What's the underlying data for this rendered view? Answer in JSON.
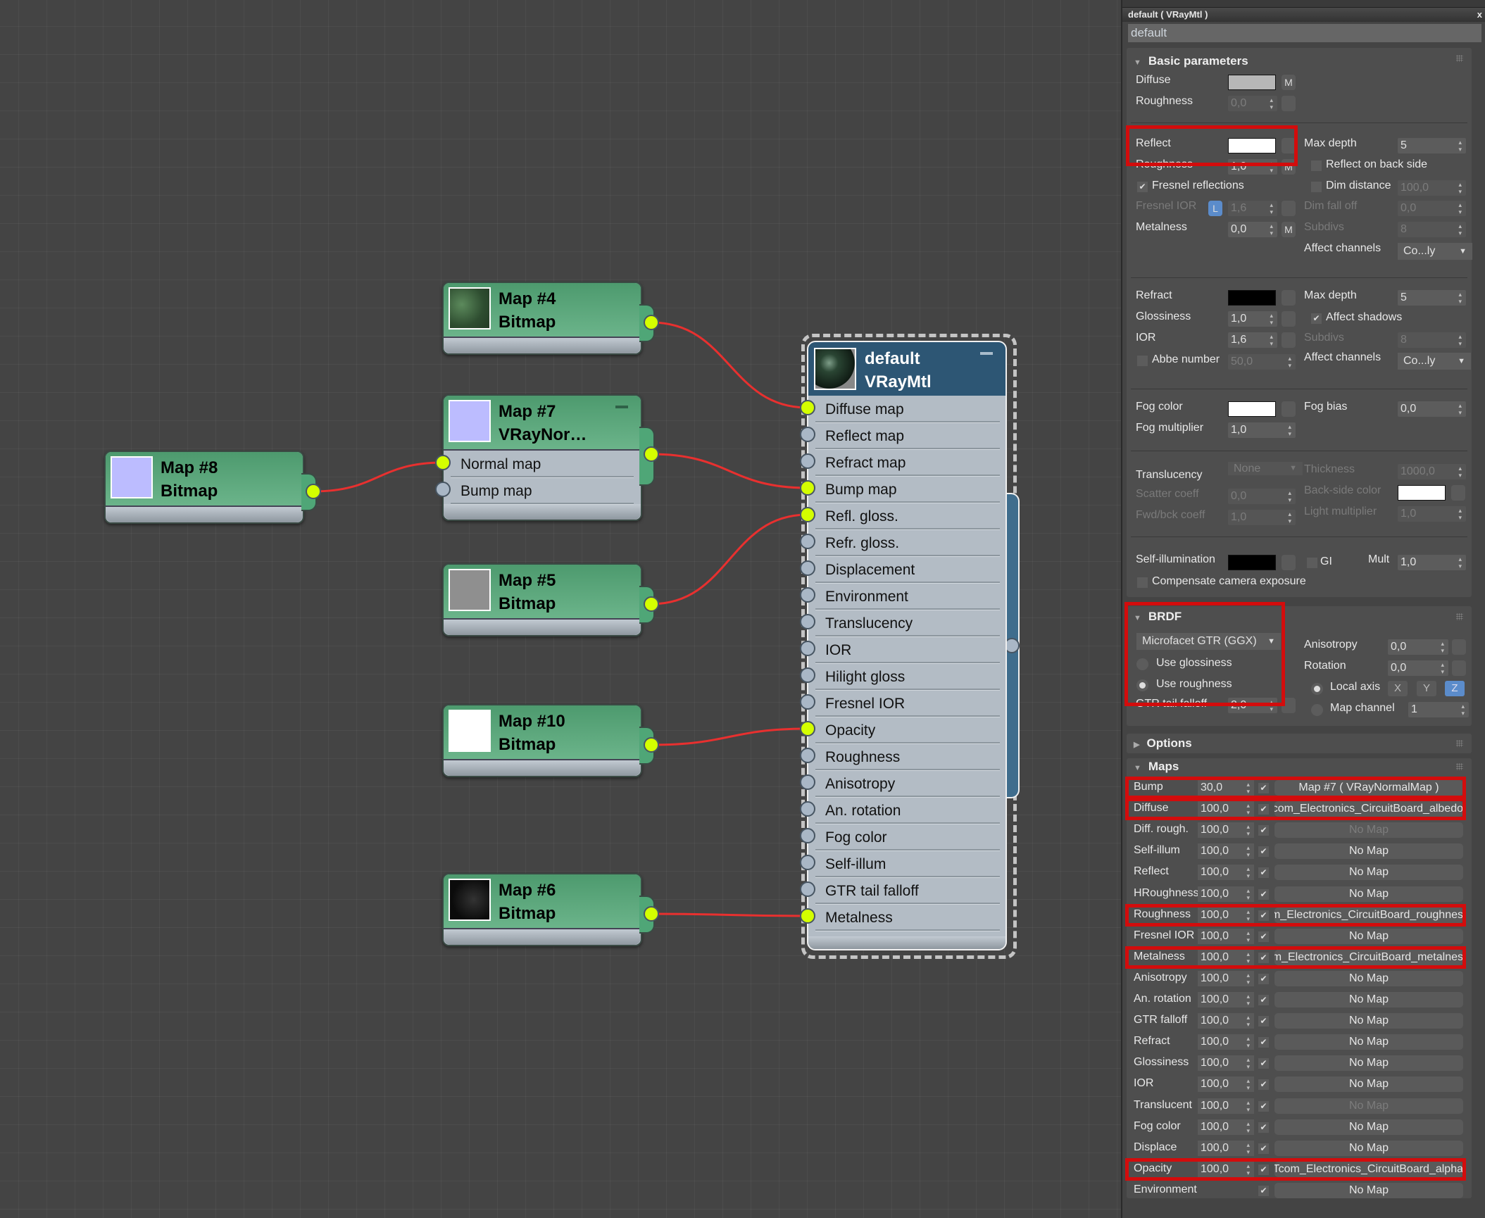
{
  "node_editor": {
    "nodes": [
      {
        "id": "map4",
        "title": "Map #4",
        "type": "Bitmap",
        "thumb": "circuit-albedo",
        "inputs": []
      },
      {
        "id": "map7",
        "title": "Map #7",
        "type": "VRayNor…",
        "thumb": "normal",
        "inputs": [
          {
            "label": "Normal map",
            "connected": true
          },
          {
            "label": "Bump map",
            "connected": false
          }
        ]
      },
      {
        "id": "map8",
        "title": "Map #8",
        "type": "Bitmap",
        "thumb": "normal",
        "inputs": []
      },
      {
        "id": "map5",
        "title": "Map #5",
        "type": "Bitmap",
        "thumb": "roughness",
        "inputs": []
      },
      {
        "id": "map10",
        "title": "Map #10",
        "type": "Bitmap",
        "thumb": "alpha",
        "inputs": []
      },
      {
        "id": "map6",
        "title": "Map #6",
        "type": "Bitmap",
        "thumb": "metalness",
        "inputs": []
      }
    ],
    "material": {
      "title": "default",
      "type": "VRayMtl",
      "slots": [
        {
          "label": "Diffuse map",
          "connected": true
        },
        {
          "label": "Reflect map",
          "connected": false
        },
        {
          "label": "Refract map",
          "connected": false
        },
        {
          "label": "Bump map",
          "connected": true
        },
        {
          "label": "Refl. gloss.",
          "connected": true
        },
        {
          "label": "Refr. gloss.",
          "connected": false
        },
        {
          "label": "Displacement",
          "connected": false
        },
        {
          "label": "Environment",
          "connected": false
        },
        {
          "label": "Translucency",
          "connected": false
        },
        {
          "label": "IOR",
          "connected": false
        },
        {
          "label": "Hilight gloss",
          "connected": false
        },
        {
          "label": "Fresnel IOR",
          "connected": false
        },
        {
          "label": "Opacity",
          "connected": true
        },
        {
          "label": "Roughness",
          "connected": false
        },
        {
          "label": "Anisotropy",
          "connected": false
        },
        {
          "label": "An. rotation",
          "connected": false
        },
        {
          "label": "Fog color",
          "connected": false
        },
        {
          "label": "Self-illum",
          "connected": false
        },
        {
          "label": "GTR tail falloff",
          "connected": false
        },
        {
          "label": "Metalness",
          "connected": true
        }
      ]
    },
    "connections": [
      {
        "from": "map4",
        "to": "Diffuse map"
      },
      {
        "from": "map8",
        "to": "map7:Normal map"
      },
      {
        "from": "map7",
        "to": "Bump map"
      },
      {
        "from": "map5",
        "to": "Refl. gloss."
      },
      {
        "from": "map10",
        "to": "Opacity"
      },
      {
        "from": "map6",
        "to": "Metalness"
      }
    ],
    "colors": {
      "wire": "#e8302f",
      "socket_on": "#d4ff00",
      "socket_off": "#a9b7c6",
      "map_node": "#5aa57a",
      "mtl_header": "#2d5674"
    }
  },
  "panel": {
    "title": "default  ( VRayMtl )",
    "close": "x",
    "name_value": "default",
    "basic": {
      "header": "Basic parameters",
      "diffuse_label": "Diffuse",
      "diffuse_color": "#b7b7b7",
      "m": "M",
      "roughness_label": "Roughness",
      "roughness_value": "0,0",
      "reflect_label": "Reflect",
      "reflect_color": "#ffffff",
      "refl_roughness_label": "Roughness",
      "refl_roughness_value": "1,0",
      "fresnel_label": "Fresnel reflections",
      "fresnel_checked": true,
      "fresnel_ior_label": "Fresnel IOR",
      "fresnel_ior_lock": "L",
      "fresnel_ior_value": "1,6",
      "metalness_label": "Metalness",
      "metalness_value": "0,0",
      "max_depth_label": "Max depth",
      "max_depth_value": "5",
      "reflect_back_label": "Reflect on back side",
      "dim_distance_label": "Dim distance",
      "dim_distance_value": "100,0",
      "dim_falloff_label": "Dim fall off",
      "dim_falloff_value": "0,0",
      "subdivs_label": "Subdivs",
      "subdivs_value": "8",
      "affect_channels_label": "Affect channels",
      "affect_channels_value": "Co...ly",
      "refract_label": "Refract",
      "refract_color": "#000000",
      "glossiness_label": "Glossiness",
      "glossiness_value": "1,0",
      "ior_label": "IOR",
      "ior_value": "1,6",
      "abbe_label": "Abbe number",
      "abbe_value": "50,0",
      "refr_max_depth_label": "Max depth",
      "refr_max_depth_value": "5",
      "affect_shadows_label": "Affect shadows",
      "affect_shadows_checked": true,
      "refr_subdivs_label": "Subdivs",
      "refr_subdivs_value": "8",
      "refr_affect_channels_label": "Affect channels",
      "refr_affect_channels_value": "Co...ly",
      "fog_color_label": "Fog color",
      "fog_color": "#ffffff",
      "fog_mult_label": "Fog multiplier",
      "fog_mult_value": "1,0",
      "fog_bias_label": "Fog bias",
      "fog_bias_value": "0,0",
      "translucency_label": "Translucency",
      "translucency_value": "None",
      "scatter_label": "Scatter coeff",
      "scatter_value": "0,0",
      "fwdbck_label": "Fwd/bck coeff",
      "fwdbck_value": "1,0",
      "thickness_label": "Thickness",
      "thickness_value": "1000,0",
      "backside_label": "Back-side color",
      "backside_color": "#ffffff",
      "light_mult_label": "Light multiplier",
      "light_mult_value": "1,0",
      "selfillum_label": "Self-illumination",
      "selfillum_color": "#000000",
      "gi_label": "GI",
      "mult_label": "Mult",
      "mult_value": "1,0",
      "compensate_label": "Compensate camera exposure"
    },
    "brdf": {
      "header": "BRDF",
      "type_value": "Microfacet GTR (GGX)",
      "use_glossiness": "Use glossiness",
      "use_roughness": "Use roughness",
      "selected": "Use roughness",
      "gtr_label": "GTR tail falloff",
      "gtr_value": "2,0",
      "anisotropy_label": "Anisotropy",
      "anisotropy_value": "0,0",
      "rotation_label": "Rotation",
      "rotation_value": "0,0",
      "local_axis_label": "Local axis",
      "axes": [
        "X",
        "Y",
        "Z"
      ],
      "selected_axis": "Z",
      "map_channel_label": "Map channel",
      "map_channel_value": "1"
    },
    "options": {
      "header": "Options"
    },
    "maps": {
      "header": "Maps",
      "rows": [
        {
          "label": "Bump",
          "amount": "30,0",
          "enabled": true,
          "map": "Map #7  ( VRayNormalMap )",
          "highlight": true,
          "kind": "map"
        },
        {
          "label": "Diffuse",
          "amount": "100,0",
          "enabled": true,
          "map": "com_Electronics_CircuitBoard_albedo_",
          "highlight": true,
          "kind": "file"
        },
        {
          "label": "Diff. rough.",
          "amount": "100,0",
          "enabled": true,
          "map": "No Map",
          "highlight": false,
          "kind": "dim"
        },
        {
          "label": "Self-illum",
          "amount": "100,0",
          "enabled": true,
          "map": "No Map",
          "highlight": false,
          "kind": "none"
        },
        {
          "label": "Reflect",
          "amount": "100,0",
          "enabled": true,
          "map": "No Map",
          "highlight": false,
          "kind": "none"
        },
        {
          "label": "HRoughness",
          "amount": "100,0",
          "enabled": true,
          "map": "No Map",
          "highlight": false,
          "kind": "none"
        },
        {
          "label": "Roughness",
          "amount": "100,0",
          "enabled": true,
          "map": "om_Electronics_CircuitBoard_roughnes",
          "highlight": true,
          "kind": "file"
        },
        {
          "label": "Fresnel IOR",
          "amount": "100,0",
          "enabled": true,
          "map": "No Map",
          "highlight": false,
          "kind": "none"
        },
        {
          "label": "Metalness",
          "amount": "100,0",
          "enabled": true,
          "map": "om_Electronics_CircuitBoard_metalnes",
          "highlight": true,
          "kind": "file"
        },
        {
          "label": "Anisotropy",
          "amount": "100,0",
          "enabled": true,
          "map": "No Map",
          "highlight": false,
          "kind": "none"
        },
        {
          "label": "An. rotation",
          "amount": "100,0",
          "enabled": true,
          "map": "No Map",
          "highlight": false,
          "kind": "none"
        },
        {
          "label": "GTR falloff",
          "amount": "100,0",
          "enabled": true,
          "map": "No Map",
          "highlight": false,
          "kind": "none"
        },
        {
          "label": "Refract",
          "amount": "100,0",
          "enabled": true,
          "map": "No Map",
          "highlight": false,
          "kind": "none"
        },
        {
          "label": "Glossiness",
          "amount": "100,0",
          "enabled": true,
          "map": "No Map",
          "highlight": false,
          "kind": "none"
        },
        {
          "label": "IOR",
          "amount": "100,0",
          "enabled": true,
          "map": "No Map",
          "highlight": false,
          "kind": "none"
        },
        {
          "label": "Translucent",
          "amount": "100,0",
          "enabled": true,
          "map": "No Map",
          "highlight": false,
          "kind": "dim"
        },
        {
          "label": "Fog color",
          "amount": "100,0",
          "enabled": true,
          "map": "No Map",
          "highlight": false,
          "kind": "none"
        },
        {
          "label": "Displace",
          "amount": "100,0",
          "enabled": true,
          "map": "No Map",
          "highlight": false,
          "kind": "none"
        },
        {
          "label": "Opacity",
          "amount": "100,0",
          "enabled": true,
          "map": "Tcom_Electronics_CircuitBoard_alpha_",
          "highlight": true,
          "kind": "file"
        },
        {
          "label": "Environment",
          "amount": null,
          "enabled": true,
          "map": "No Map",
          "highlight": false,
          "kind": "none"
        }
      ]
    },
    "highlight_color": "#d30c0c",
    "check_mark": "✔"
  }
}
